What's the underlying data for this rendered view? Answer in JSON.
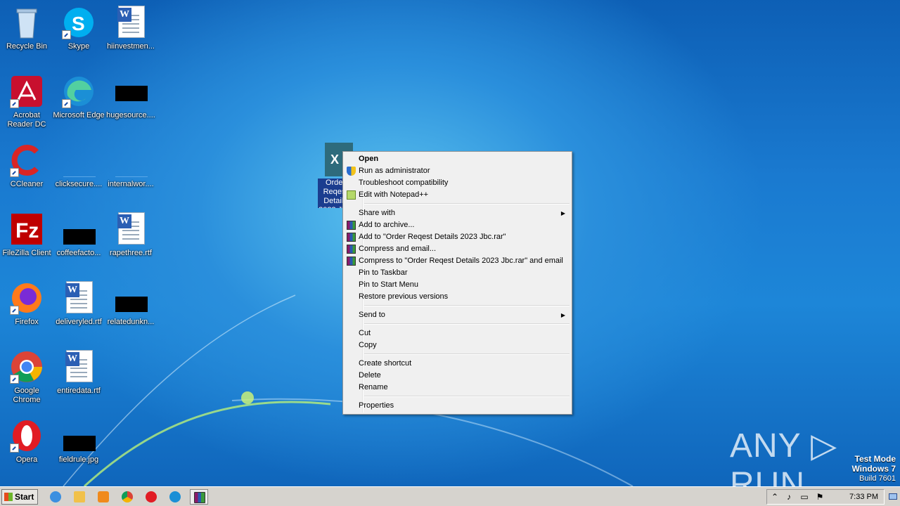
{
  "desktop": {
    "icons": [
      {
        "label": "Recycle Bin",
        "icon": "recycle-bin-icon"
      },
      {
        "label": "Skype",
        "icon": "skype-icon"
      },
      {
        "label": "hiinvestmen...",
        "icon": "word-document-icon"
      },
      {
        "label": "Acrobat Reader DC",
        "icon": "acrobat-icon"
      },
      {
        "label": "Microsoft Edge",
        "icon": "edge-icon"
      },
      {
        "label": "hugesource....",
        "icon": "blank-file-icon"
      },
      {
        "label": "CCleaner",
        "icon": "ccleaner-icon"
      },
      {
        "label": "clicksecure....",
        "icon": "blank-file-icon"
      },
      {
        "label": "internalwor....",
        "icon": "blank-file-icon"
      },
      {
        "label": "FileZilla Client",
        "icon": "filezilla-icon"
      },
      {
        "label": "coffeefacto...",
        "icon": "blank-file-icon"
      },
      {
        "label": "rapethree.rtf",
        "icon": "word-document-icon"
      },
      {
        "label": "Firefox",
        "icon": "firefox-icon"
      },
      {
        "label": "deliveryled.rtf",
        "icon": "word-document-icon"
      },
      {
        "label": "relatedunkn...",
        "icon": "blank-file-icon"
      },
      {
        "label": "Google Chrome",
        "icon": "chrome-icon"
      },
      {
        "label": "entiredata.rtf",
        "icon": "word-document-icon"
      },
      {
        "label": "Opera",
        "icon": "opera-icon"
      },
      {
        "label": "fieldrule.jpg",
        "icon": "blank-file-icon"
      }
    ],
    "selected_file": {
      "label": "Order Reqest Details 2023 Jbc.",
      "icon_text": "X"
    }
  },
  "context_menu": {
    "items": [
      {
        "label": "Open",
        "bold": true
      },
      {
        "label": "Run as administrator",
        "icon": "uac-shield-icon"
      },
      {
        "label": "Troubleshoot compatibility"
      },
      {
        "label": "Edit with Notepad++",
        "icon": "notepadpp-icon"
      },
      {
        "label": "Share with",
        "submenu": true
      },
      {
        "label": "Add to archive...",
        "icon": "winrar-icon"
      },
      {
        "label": "Add to \"Order Reqest Details 2023 Jbc.rar\"",
        "icon": "winrar-icon"
      },
      {
        "label": "Compress and email...",
        "icon": "winrar-icon"
      },
      {
        "label": "Compress to \"Order Reqest Details 2023 Jbc.rar\" and email",
        "icon": "winrar-icon"
      },
      {
        "label": "Pin to Taskbar"
      },
      {
        "label": "Pin to Start Menu"
      },
      {
        "label": "Restore previous versions"
      },
      {
        "label": "Send to",
        "submenu": true
      },
      {
        "label": "Cut"
      },
      {
        "label": "Copy"
      },
      {
        "label": "Create shortcut"
      },
      {
        "label": "Delete"
      },
      {
        "label": "Rename"
      },
      {
        "label": "Properties"
      }
    ],
    "submenu_arrow": "▶"
  },
  "watermark": "ANY ▷ RUN",
  "os_info": {
    "line1": "Test Mode",
    "line2": "Windows 7",
    "line3": "Build 7601"
  },
  "taskbar": {
    "start_label": "Start",
    "apps": [
      "ie-icon",
      "explorer-icon",
      "media-player-icon",
      "chrome-icon",
      "opera-icon",
      "edge-icon",
      "winrar-icon"
    ],
    "tray_icons": [
      "tray-chevron-icon",
      "volume-icon",
      "network-icon",
      "action-center-flag-icon"
    ],
    "clock": "7:33 PM"
  }
}
